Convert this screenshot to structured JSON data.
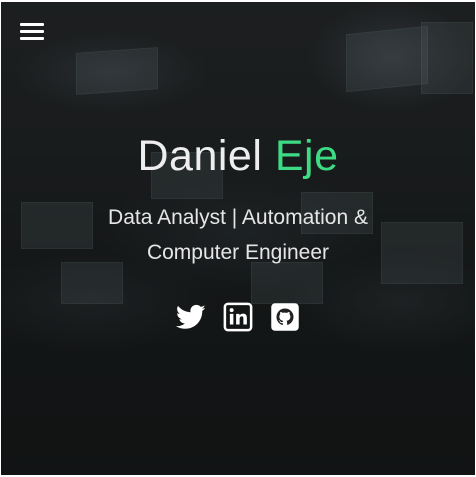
{
  "hero": {
    "first_name": "Daniel",
    "last_name": "Eje",
    "tagline": "Data Analyst | Automation & Computer Engineer",
    "accent_color": "#3ddc84"
  },
  "nav": {
    "menu_icon": "hamburger-menu-icon"
  },
  "socials": [
    {
      "name": "twitter",
      "icon": "twitter-icon"
    },
    {
      "name": "linkedin",
      "icon": "linkedin-icon"
    },
    {
      "name": "github",
      "icon": "github-icon"
    }
  ]
}
